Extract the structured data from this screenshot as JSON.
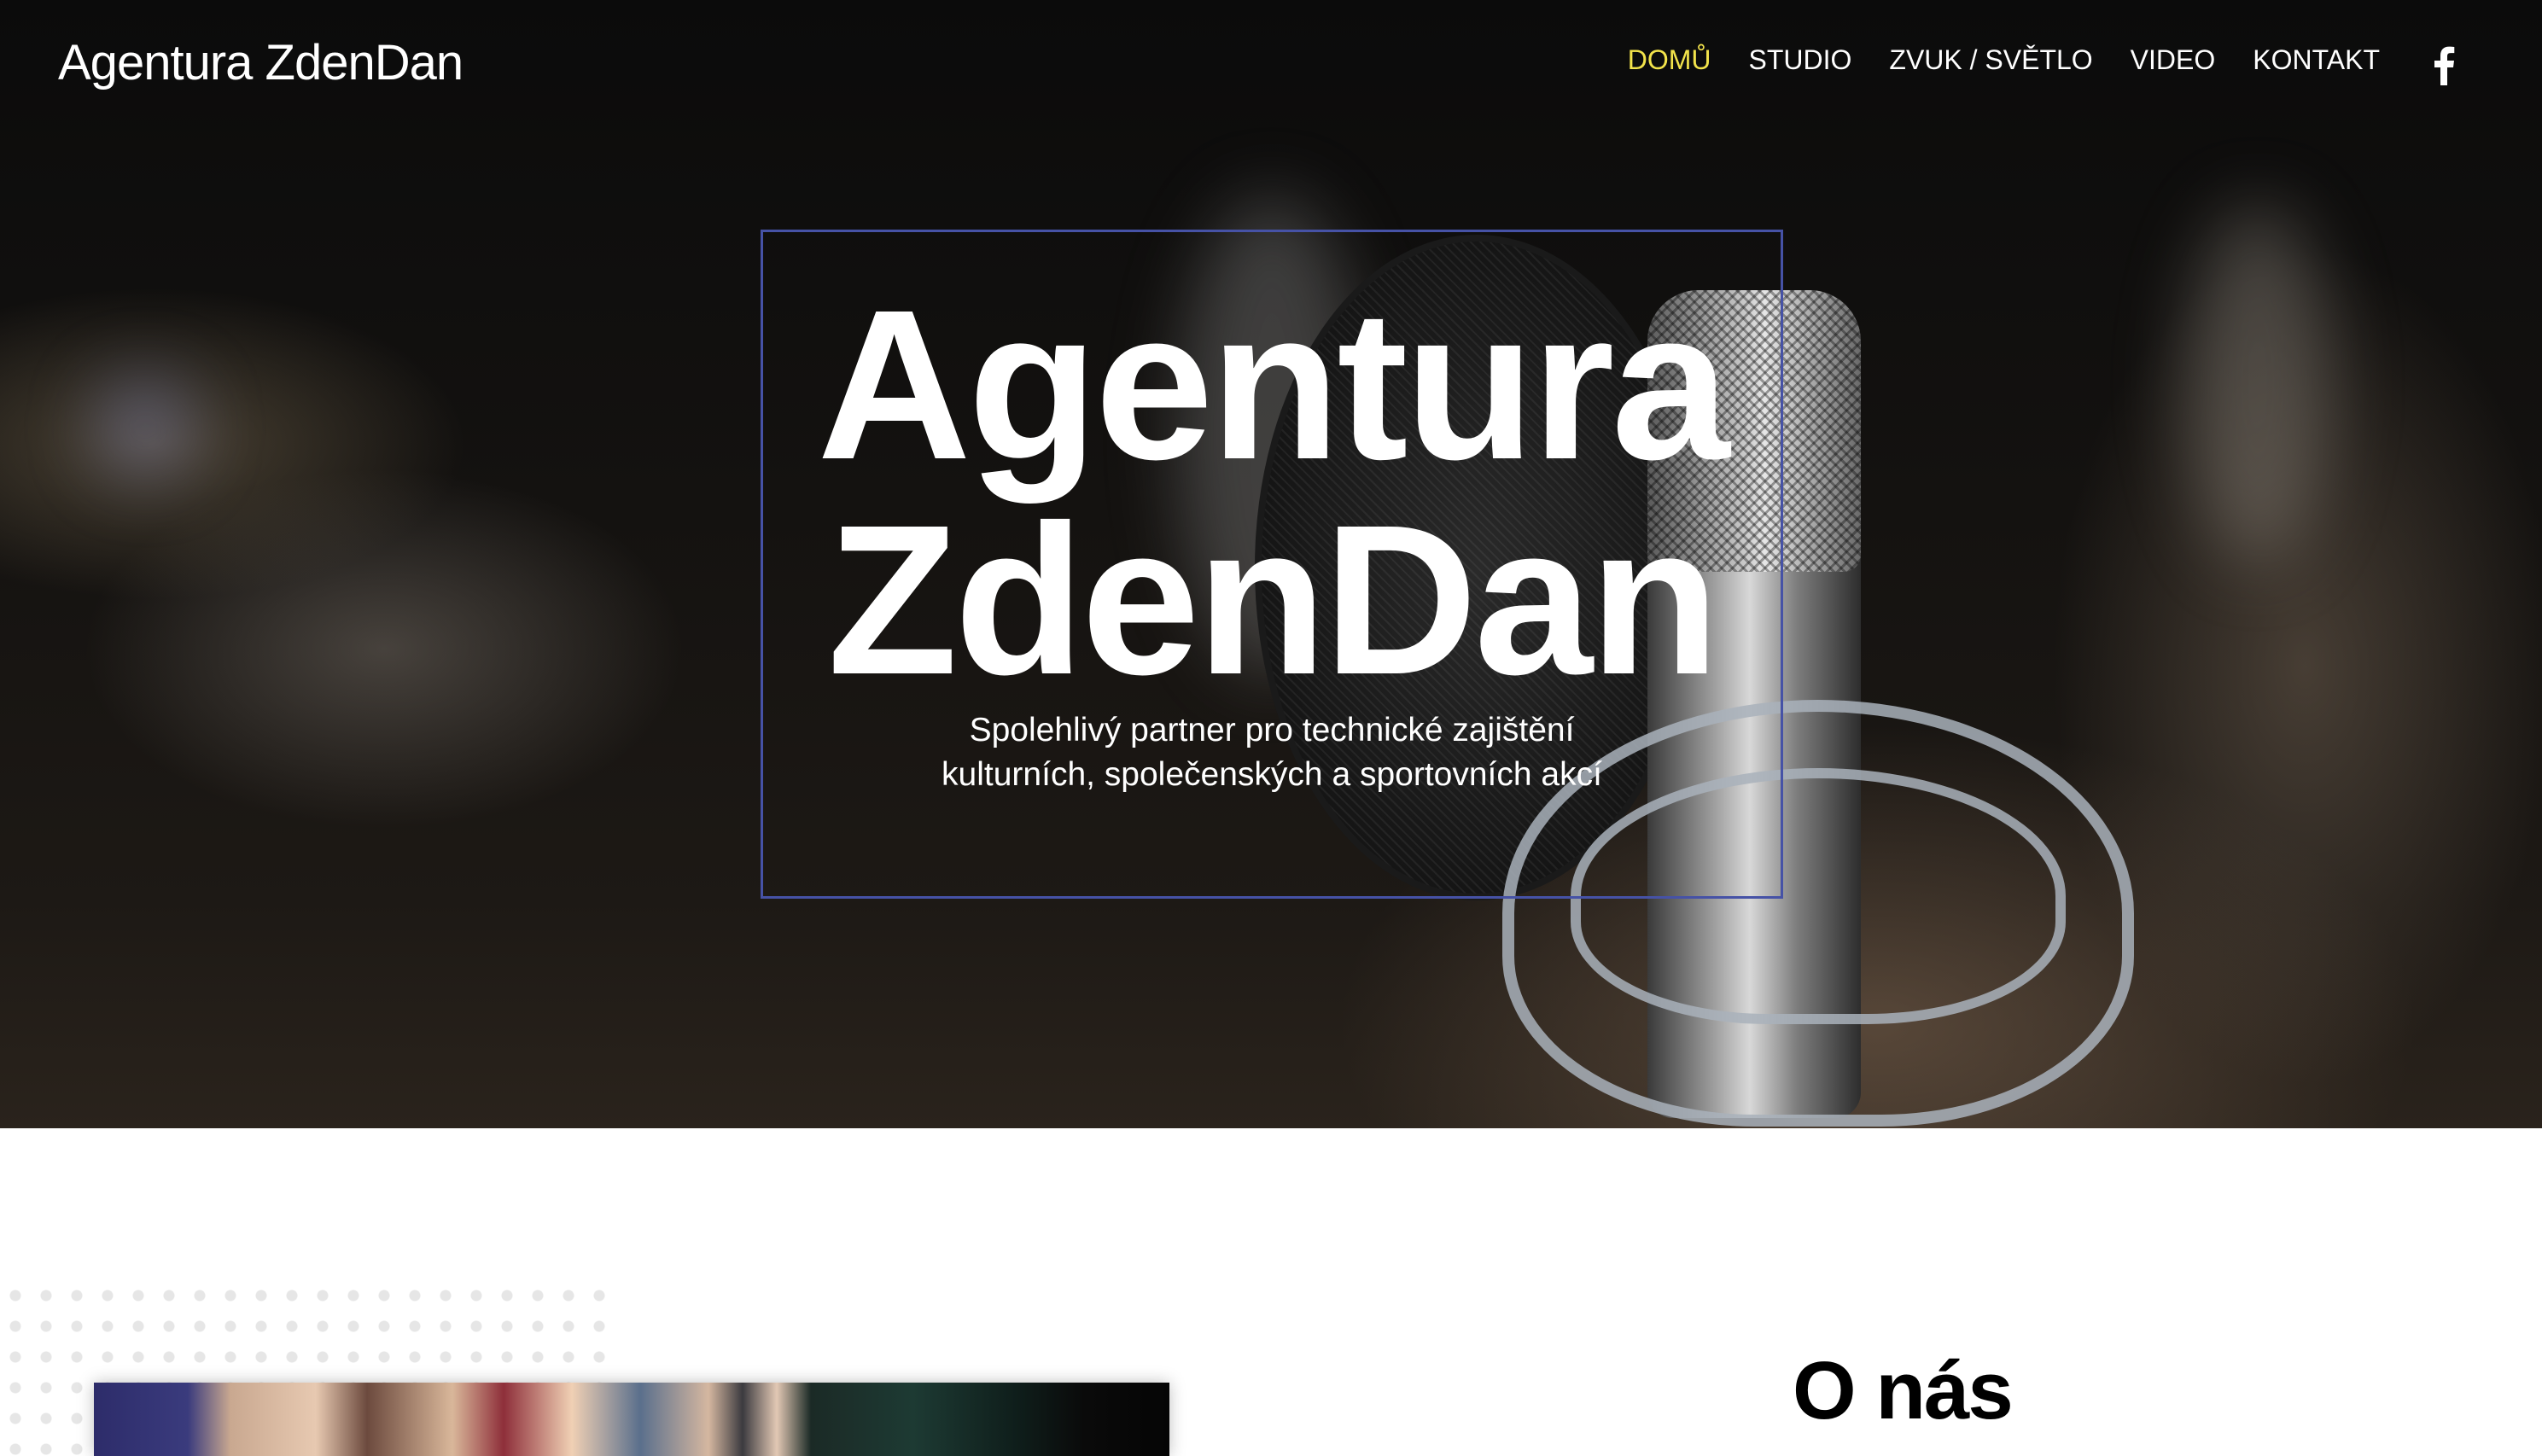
{
  "header": {
    "logo": "Agentura ZdenDan",
    "nav": [
      {
        "label": "DOMŮ",
        "active": true
      },
      {
        "label": "STUDIO",
        "active": false
      },
      {
        "label": "ZVUK / SVĚTLO",
        "active": false
      },
      {
        "label": "VIDEO",
        "active": false
      },
      {
        "label": "KONTAKT",
        "active": false
      }
    ],
    "social_icon": "facebook-icon"
  },
  "hero": {
    "title_line1": "Agentura",
    "title_line2": "ZdenDan",
    "subtitle_line1": "Spolehlivý partner pro technické zajištění",
    "subtitle_line2": "kulturních, společenských a sportovních akcí"
  },
  "about": {
    "title": "O nás"
  },
  "colors": {
    "nav_active": "#f2e34b",
    "hero_box_border": "#4652a6",
    "text_light": "#ffffff",
    "text_dark": "#000000"
  }
}
